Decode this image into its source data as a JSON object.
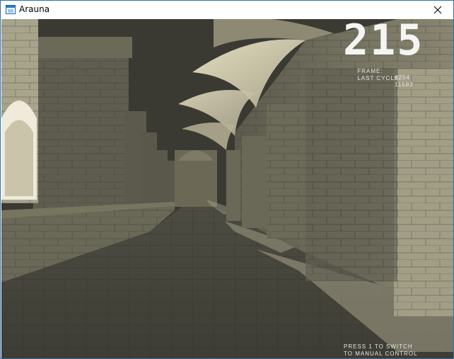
{
  "window": {
    "title": "Arauna",
    "app_icon": "window-app-icon",
    "close_icon": "close-icon"
  },
  "hud": {
    "fps": "215",
    "frame_label": "FRAME:",
    "frame_value": "4254",
    "last_cycle_label": "LAST CYCLE:",
    "last_cycle_value": "11582",
    "hint_line1": "PRESS 1 TO SWITCH",
    "hint_line2": "TO MANUAL CONTROL"
  },
  "colors": {
    "window_border": "#2b6fb0",
    "sky": "#3a3a33",
    "stone_light": "#d9d4bd",
    "stone_mid": "#8e8a74",
    "stone_dark": "#4b4a3f",
    "hud_text": "#f4f4f2"
  }
}
